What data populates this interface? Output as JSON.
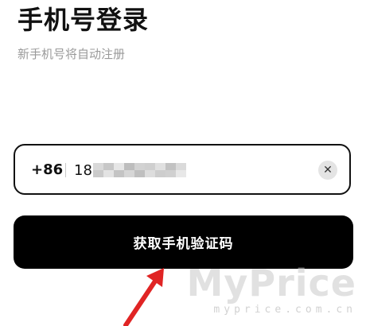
{
  "header": {
    "title": "手机号登录",
    "subtitle": "新手机号将自动注册"
  },
  "phone_field": {
    "country_code": "+86",
    "value_visible_prefix": "18",
    "value_masked": true,
    "clear_icon": "close-circle-icon"
  },
  "actions": {
    "submit_label": "获取手机验证码"
  },
  "annotation": {
    "arrow_color": "#e02424"
  },
  "watermark": {
    "brand": "MyPrice",
    "domain": "myprice.com.cn"
  },
  "colors": {
    "primary_button": "#000000",
    "accent_arrow": "#e02424",
    "subtitle_gray": "#9a9a9a"
  }
}
